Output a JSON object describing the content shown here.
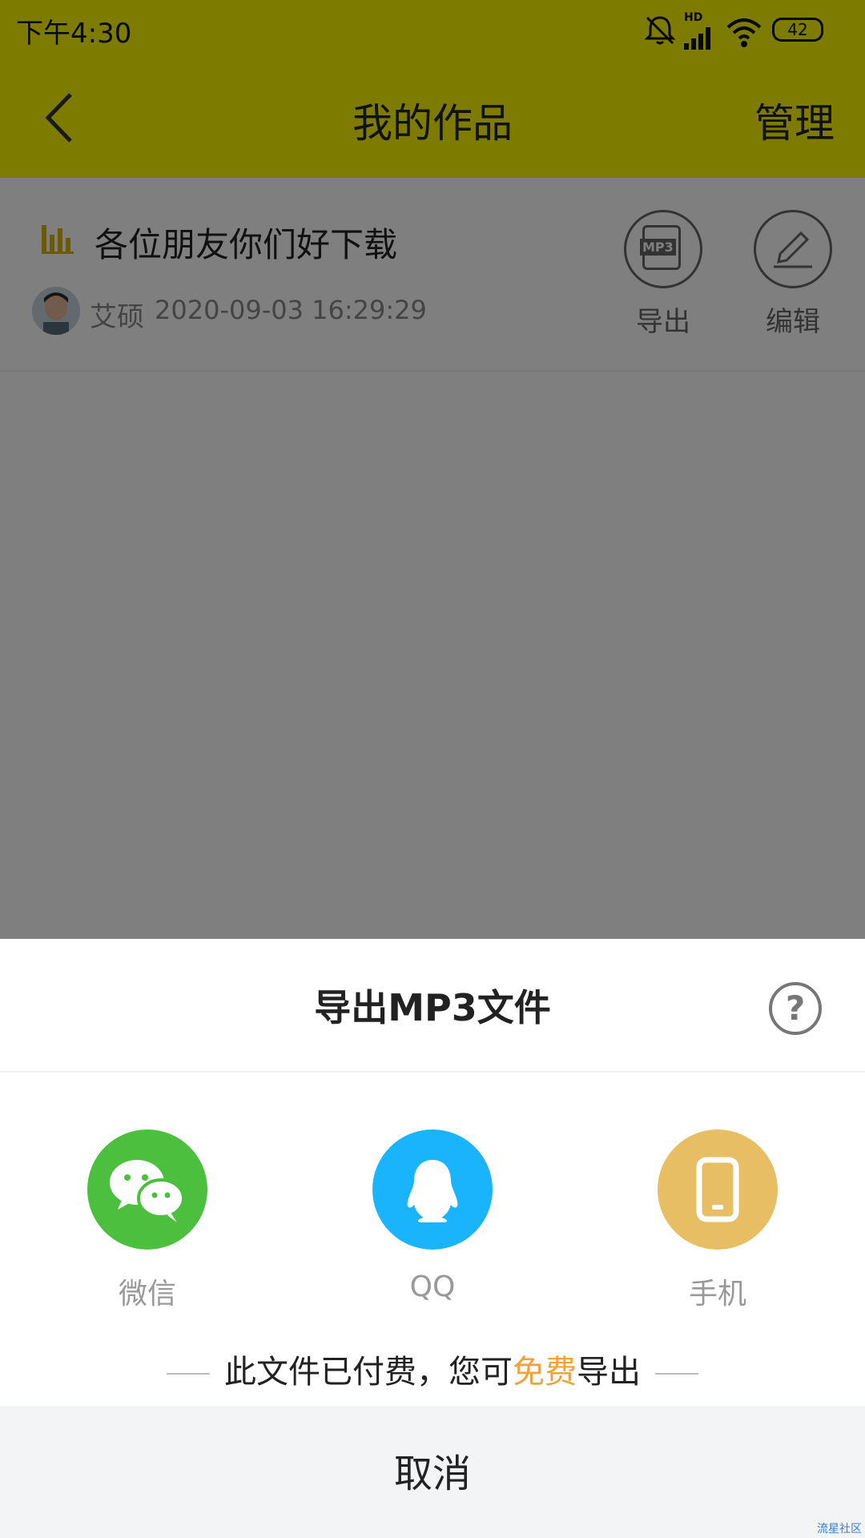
{
  "status_bar": {
    "time": "下午4:30",
    "hd": "HD",
    "battery": "42"
  },
  "header": {
    "title": "我的作品",
    "manage": "管理"
  },
  "work": {
    "title": "各位朋友你们好下载",
    "author": "艾硕",
    "date": "2020-09-03 16:29:29",
    "mp3_badge": "MP3",
    "export_label": "导出",
    "edit_label": "编辑"
  },
  "sheet": {
    "title": "导出MP3文件",
    "help": "?",
    "options": [
      {
        "label": "微信",
        "icon": "wechat-icon",
        "color": "#4cbf3f"
      },
      {
        "label": "QQ",
        "icon": "qq-icon",
        "color": "#19b4fb"
      },
      {
        "label": "手机",
        "icon": "phone-icon",
        "color": "#e8be64"
      }
    ],
    "note_prefix": "此文件已付费，您可",
    "note_free": "免费",
    "note_suffix": "导出",
    "cancel": "取消"
  },
  "watermark": "流星社区",
  "colors": {
    "accent_yellow": "#fdf800",
    "free_orange": "#f0a23c",
    "overlay": "rgba(0,0,0,0.5)"
  }
}
